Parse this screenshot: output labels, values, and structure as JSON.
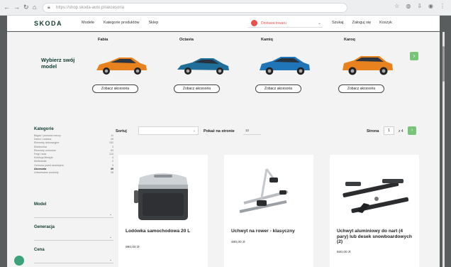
{
  "browser": {
    "url": "https://shop.skoda-auto.pl/akcesoria"
  },
  "header": {
    "logo": "SKODA",
    "menu": [
      "Modele",
      "Kategorie produktów",
      "Sklep"
    ],
    "cart_text": "Dostawa towaru",
    "actions": [
      "Szukaj",
      "Zaloguj się",
      "Koszyk"
    ]
  },
  "models": {
    "label": "Wybierz swój model",
    "button_label": "Zobacz akcesoria",
    "items": [
      {
        "name": "Fabia",
        "color": "#e8821e"
      },
      {
        "name": "Octavia",
        "color": "#1f6f9a"
      },
      {
        "name": "Kamiq",
        "color": "#1f75b8"
      },
      {
        "name": "Karoq",
        "color": "#e8821e"
      }
    ]
  },
  "sidebar": {
    "title": "Kategorie",
    "categories": [
      {
        "label": "Bagaż i przewóz rzeczy",
        "count": "11"
      },
      {
        "label": "Dzieci i rodzina",
        "count": "49"
      },
      {
        "label": "Elementy dekoracyjne",
        "count": "152"
      },
      {
        "label": "Elektronika",
        "count": "3"
      },
      {
        "label": "Elementy ochronne",
        "count": "63"
      },
      {
        "label": "Felgi i koła",
        "count": "124"
      },
      {
        "label": "Kolekcja lifestyle",
        "count": "4"
      },
      {
        "label": "Multimedia",
        "count": "2"
      },
      {
        "label": "Ochrona przed złodziejem",
        "count": "3"
      },
      {
        "label": "Akcesoria",
        "count": "39"
      },
      {
        "label": "Uniwersalne produkty",
        "count": "28"
      }
    ],
    "filters": [
      "Model",
      "Generacja",
      "Cena"
    ]
  },
  "toolbar": {
    "sort_label": "Sortuj",
    "per_page_label": "Pokaż na stronie",
    "per_page_value": "12",
    "page_label": "Strona",
    "page_current": "1",
    "page_total": "z 4"
  },
  "products": [
    {
      "title": "Lodówka samochodowa 20 L",
      "price": "990,00 zł"
    },
    {
      "title": "Uchwyt na rower - klasyczny",
      "price": "490,00 zł"
    },
    {
      "title": "Uchwyt aluminiowy do nart (4 pary) lub desek snowboardowych (2)",
      "price": "840,00 zł"
    }
  ],
  "colors": {
    "accent": "#78c57a",
    "brand": "#0e3a2f",
    "cart": "#e9514a"
  }
}
